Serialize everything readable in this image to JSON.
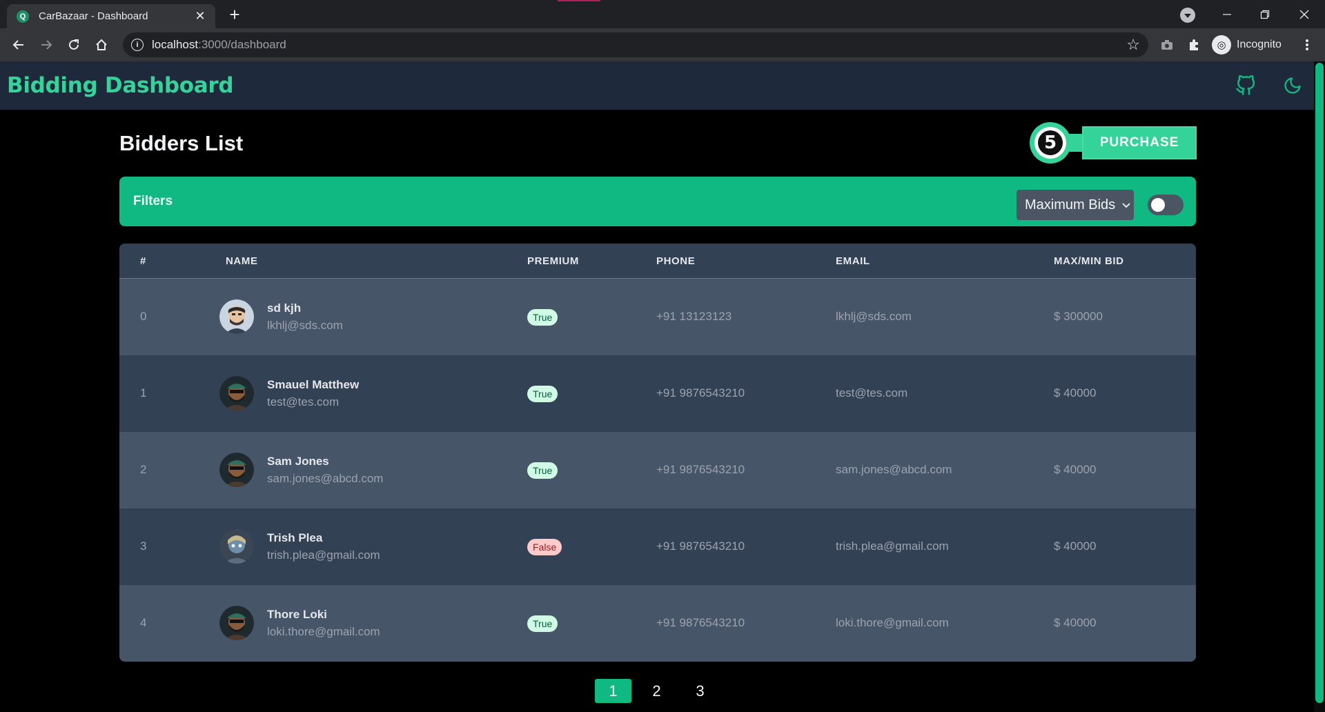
{
  "browser": {
    "tab_title": "CarBazaar - Dashboard",
    "tab_favicon": "car-bazaar-favicon",
    "new_tab_label": "+",
    "url_host": "localhost",
    "url_path": ":3000/dashboard",
    "profile_label": "Incognito"
  },
  "navbar": {
    "brand": "Bidding Dashboard",
    "icons": [
      "github-icon",
      "moon-icon"
    ]
  },
  "page": {
    "title": "Bidders List",
    "purchase_label": "PURCHASE",
    "purchase_logo_letter": "5"
  },
  "filters": {
    "label": "Filters",
    "sort_selected": "Maximum Bids",
    "toggle_on": false
  },
  "table": {
    "headers": [
      "#",
      "NAME",
      "PREMIUM",
      "PHONE",
      "EMAIL",
      "MAX/MIN BID"
    ],
    "rows": [
      {
        "index": "0",
        "name": "sd kjh",
        "sub_email": "lkhlj@sds.com",
        "premium": "True",
        "phone": "+91 13123123",
        "email": "lkhlj@sds.com",
        "bid": "$ 300000"
      },
      {
        "index": "1",
        "name": "Smauel Matthew",
        "sub_email": "test@tes.com",
        "premium": "True",
        "phone": "+91 9876543210",
        "email": "test@tes.com",
        "bid": "$ 40000"
      },
      {
        "index": "2",
        "name": "Sam Jones",
        "sub_email": "sam.jones@abcd.com",
        "premium": "True",
        "phone": "+91 9876543210",
        "email": "sam.jones@abcd.com",
        "bid": "$ 40000"
      },
      {
        "index": "3",
        "name": "Trish Plea",
        "sub_email": "trish.plea@gmail.com",
        "premium": "False",
        "phone": "+91 9876543210",
        "email": "trish.plea@gmail.com",
        "bid": "$ 40000"
      },
      {
        "index": "4",
        "name": "Thore Loki",
        "sub_email": "loki.thore@gmail.com",
        "premium": "True",
        "phone": "+91 9876543210",
        "email": "loki.thore@gmail.com",
        "bid": "$ 40000"
      }
    ]
  },
  "pagination": {
    "pages": [
      "1",
      "2",
      "3"
    ],
    "current": "1"
  },
  "colors": {
    "accent": "#10b981",
    "brand_text": "#34d399",
    "navbar_bg": "#1e293b",
    "row_light": "#475569",
    "row_dark": "#334155"
  }
}
